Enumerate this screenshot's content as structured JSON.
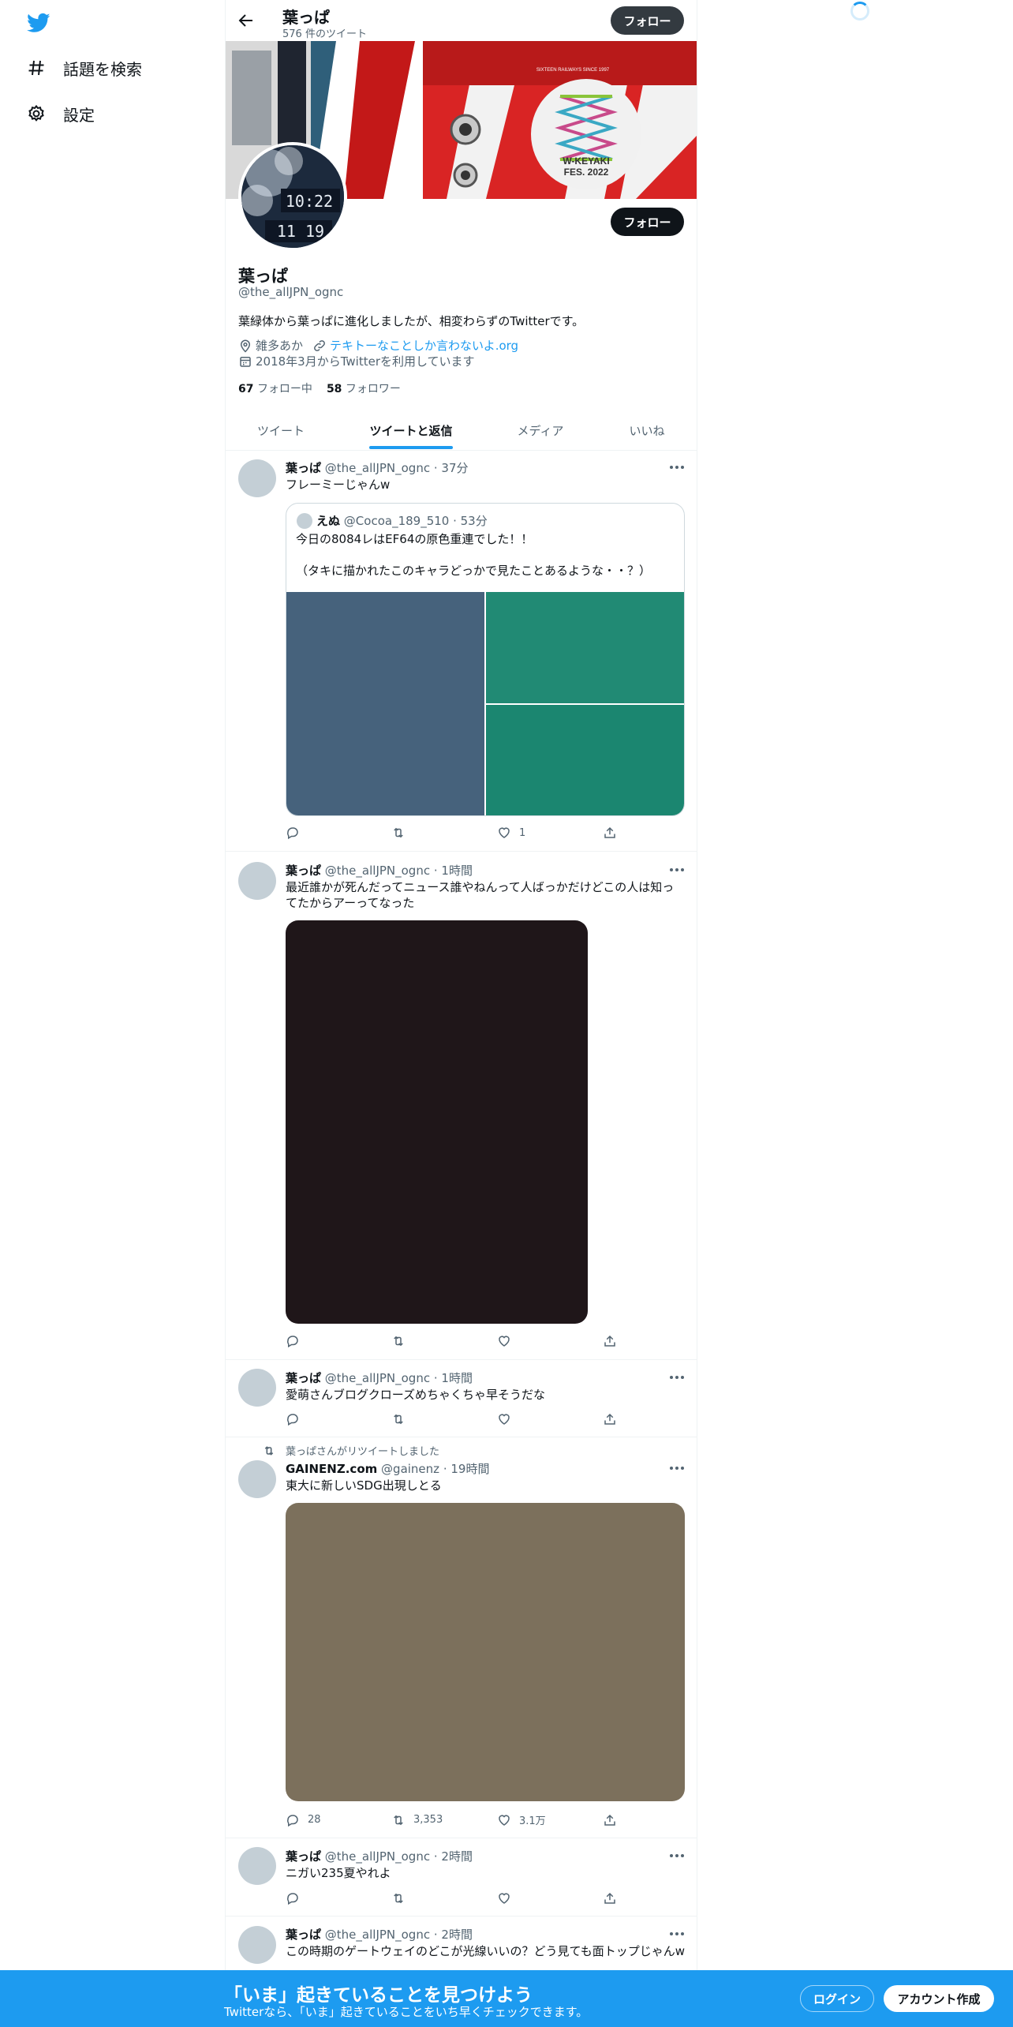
{
  "nav": {
    "items": [
      {
        "label": "話題を検索",
        "icon": "hashtag-icon"
      },
      {
        "label": "設定",
        "icon": "gear-icon"
      }
    ]
  },
  "header": {
    "name": "葉っぱ",
    "tweet_count": "576 件のツイート",
    "follow_label": "フォロー"
  },
  "profile": {
    "name": "葉っぱ",
    "handle": "@the_allJPN_ognc",
    "bio": "葉緑体から葉っぱに進化しましたが、相変わらずのTwitterです。",
    "location": "雑多あか",
    "website": "テキトーなことしか言わないよ.org",
    "joined": "2018年3月からTwitterを利用しています",
    "following_count": "67",
    "following_label": "フォロー中",
    "followers_count": "58",
    "followers_label": "フォロワー",
    "follow_label": "フォロー",
    "banner_texts": {
      "fes": "W-KEYAKI\nFES. 2022",
      "railway": "SIXTEEN RAILWAYS SINCE 1997"
    },
    "avatar_clock": "10:22"
  },
  "tabs": [
    {
      "label": "ツイート",
      "active": false
    },
    {
      "label": "ツイートと返信",
      "active": true
    },
    {
      "label": "メディア",
      "active": false
    },
    {
      "label": "いいね",
      "active": false
    }
  ],
  "tweets": [
    {
      "name": "葉っぱ",
      "handle": "@the_allJPN_ognc",
      "time": "37分",
      "text": "フレーミーじゃんw",
      "quote": {
        "name": "えぬ",
        "handle": "@Cocoa_189_510",
        "time": "53分",
        "line1": "今日の8084レはEF64の原色重連でした！！",
        "line2": "（タキに描かれたこのキャラどっかで見たことあるような・・？）"
      },
      "likes": "1",
      "replies": "",
      "retweets": ""
    },
    {
      "name": "葉っぱ",
      "handle": "@the_allJPN_ognc",
      "time": "1時間",
      "text": "最近誰かが死んだってニュース誰やねんって人ばっかだけどこの人は知ってたからアーってなった",
      "likes": "",
      "replies": "",
      "retweets": ""
    },
    {
      "name": "葉っぱ",
      "handle": "@the_allJPN_ognc",
      "time": "1時間",
      "text": "愛萌さんブログクローズめちゃくちゃ早そうだな",
      "likes": "",
      "replies": "",
      "retweets": ""
    },
    {
      "retweeted_by": "葉っぱさんがリツイートしました",
      "name": "GAINENZ.com",
      "handle": "@gainenz",
      "time": "19時間",
      "text": "東大に新しいSDG出現しとる",
      "replies": "28",
      "retweets": "3,353",
      "likes": "3.1万"
    },
    {
      "name": "葉っぱ",
      "handle": "@the_allJPN_ognc",
      "time": "2時間",
      "text": "ニガい235夏やれよ",
      "likes": "",
      "replies": "",
      "retweets": ""
    },
    {
      "name": "葉っぱ",
      "handle": "@the_allJPN_ognc",
      "time": "2時間",
      "text": "この時期のゲートウェイのどこが光線いいの？どう見ても面トップじゃんw"
    }
  ],
  "bottom_bar": {
    "title": "「いま」起きていることを見つけよう",
    "subtitle": "Twitterなら、「いま」起きていることをいち早くチェックできます。",
    "login": "ログイン",
    "signup": "アカウント作成"
  },
  "colors": {
    "accent": "#1d9bf0",
    "text": "#0f1419",
    "muted": "#536471"
  }
}
